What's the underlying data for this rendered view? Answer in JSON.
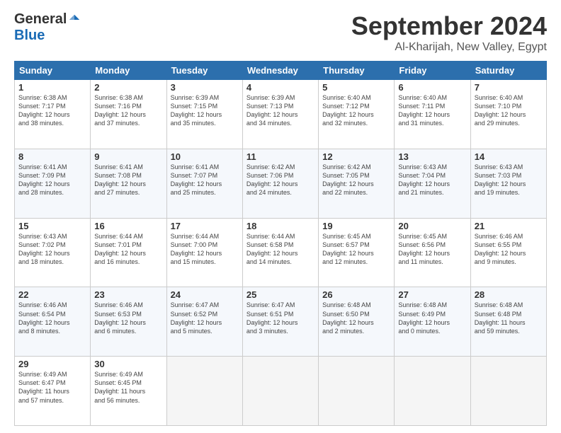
{
  "header": {
    "logo": {
      "general": "General",
      "blue": "Blue"
    },
    "title": "September 2024",
    "location": "Al-Kharijah, New Valley, Egypt"
  },
  "weekdays": [
    "Sunday",
    "Monday",
    "Tuesday",
    "Wednesday",
    "Thursday",
    "Friday",
    "Saturday"
  ],
  "weeks": [
    [
      {
        "day": "1",
        "sunrise": "6:38 AM",
        "sunset": "7:17 PM",
        "daylight": "12 hours and 38 minutes."
      },
      {
        "day": "2",
        "sunrise": "6:38 AM",
        "sunset": "7:16 PM",
        "daylight": "12 hours and 37 minutes."
      },
      {
        "day": "3",
        "sunrise": "6:39 AM",
        "sunset": "7:15 PM",
        "daylight": "12 hours and 35 minutes."
      },
      {
        "day": "4",
        "sunrise": "6:39 AM",
        "sunset": "7:13 PM",
        "daylight": "12 hours and 34 minutes."
      },
      {
        "day": "5",
        "sunrise": "6:40 AM",
        "sunset": "7:12 PM",
        "daylight": "12 hours and 32 minutes."
      },
      {
        "day": "6",
        "sunrise": "6:40 AM",
        "sunset": "7:11 PM",
        "daylight": "12 hours and 31 minutes."
      },
      {
        "day": "7",
        "sunrise": "6:40 AM",
        "sunset": "7:10 PM",
        "daylight": "12 hours and 29 minutes."
      }
    ],
    [
      {
        "day": "8",
        "sunrise": "6:41 AM",
        "sunset": "7:09 PM",
        "daylight": "12 hours and 28 minutes."
      },
      {
        "day": "9",
        "sunrise": "6:41 AM",
        "sunset": "7:08 PM",
        "daylight": "12 hours and 27 minutes."
      },
      {
        "day": "10",
        "sunrise": "6:41 AM",
        "sunset": "7:07 PM",
        "daylight": "12 hours and 25 minutes."
      },
      {
        "day": "11",
        "sunrise": "6:42 AM",
        "sunset": "7:06 PM",
        "daylight": "12 hours and 24 minutes."
      },
      {
        "day": "12",
        "sunrise": "6:42 AM",
        "sunset": "7:05 PM",
        "daylight": "12 hours and 22 minutes."
      },
      {
        "day": "13",
        "sunrise": "6:43 AM",
        "sunset": "7:04 PM",
        "daylight": "12 hours and 21 minutes."
      },
      {
        "day": "14",
        "sunrise": "6:43 AM",
        "sunset": "7:03 PM",
        "daylight": "12 hours and 19 minutes."
      }
    ],
    [
      {
        "day": "15",
        "sunrise": "6:43 AM",
        "sunset": "7:02 PM",
        "daylight": "12 hours and 18 minutes."
      },
      {
        "day": "16",
        "sunrise": "6:44 AM",
        "sunset": "7:01 PM",
        "daylight": "12 hours and 16 minutes."
      },
      {
        "day": "17",
        "sunrise": "6:44 AM",
        "sunset": "7:00 PM",
        "daylight": "12 hours and 15 minutes."
      },
      {
        "day": "18",
        "sunrise": "6:44 AM",
        "sunset": "6:58 PM",
        "daylight": "12 hours and 14 minutes."
      },
      {
        "day": "19",
        "sunrise": "6:45 AM",
        "sunset": "6:57 PM",
        "daylight": "12 hours and 12 minutes."
      },
      {
        "day": "20",
        "sunrise": "6:45 AM",
        "sunset": "6:56 PM",
        "daylight": "12 hours and 11 minutes."
      },
      {
        "day": "21",
        "sunrise": "6:46 AM",
        "sunset": "6:55 PM",
        "daylight": "12 hours and 9 minutes."
      }
    ],
    [
      {
        "day": "22",
        "sunrise": "6:46 AM",
        "sunset": "6:54 PM",
        "daylight": "12 hours and 8 minutes."
      },
      {
        "day": "23",
        "sunrise": "6:46 AM",
        "sunset": "6:53 PM",
        "daylight": "12 hours and 6 minutes."
      },
      {
        "day": "24",
        "sunrise": "6:47 AM",
        "sunset": "6:52 PM",
        "daylight": "12 hours and 5 minutes."
      },
      {
        "day": "25",
        "sunrise": "6:47 AM",
        "sunset": "6:51 PM",
        "daylight": "12 hours and 3 minutes."
      },
      {
        "day": "26",
        "sunrise": "6:48 AM",
        "sunset": "6:50 PM",
        "daylight": "12 hours and 2 minutes."
      },
      {
        "day": "27",
        "sunrise": "6:48 AM",
        "sunset": "6:49 PM",
        "daylight": "12 hours and 0 minutes."
      },
      {
        "day": "28",
        "sunrise": "6:48 AM",
        "sunset": "6:48 PM",
        "daylight": "11 hours and 59 minutes."
      }
    ],
    [
      {
        "day": "29",
        "sunrise": "6:49 AM",
        "sunset": "6:47 PM",
        "daylight": "11 hours and 57 minutes."
      },
      {
        "day": "30",
        "sunrise": "6:49 AM",
        "sunset": "6:45 PM",
        "daylight": "11 hours and 56 minutes."
      },
      null,
      null,
      null,
      null,
      null
    ]
  ]
}
